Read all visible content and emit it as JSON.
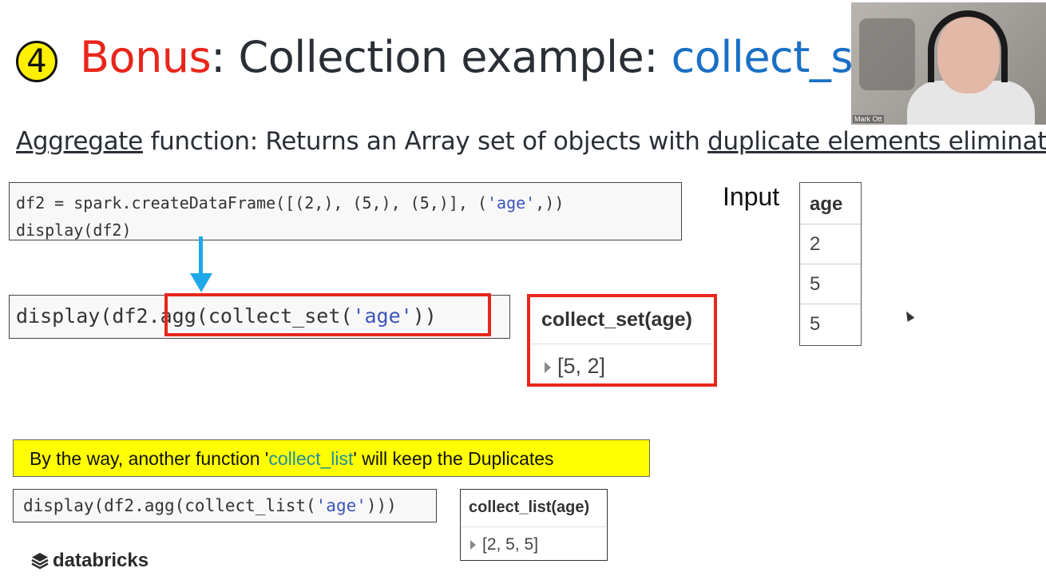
{
  "title": {
    "number": "4",
    "bonus": "Bonus",
    "separator": ": Collection example: ",
    "function_name": "collect_set"
  },
  "webcam": {
    "name": "Mark Ott"
  },
  "subtitle": {
    "part1": "Aggregate",
    "part2": " function: Returns an Array set of objects with ",
    "part3": "duplicate elements eliminated"
  },
  "code_create": {
    "line1_a": "df2 = spark.createDataFrame([(2,), (5,), (5,)], (",
    "line1_str": "'age'",
    "line1_b": ",))",
    "line2": "display(df2)"
  },
  "code_agg": {
    "a": "display(df2.agg(collect_set(",
    "str": "'age'",
    "b": "))"
  },
  "result_set": {
    "header": "collect_set(age)",
    "value": "[5, 2]"
  },
  "input": {
    "label": "Input",
    "header": "age",
    "values": [
      "2",
      "5",
      "5"
    ]
  },
  "note": {
    "a": "By the way, another function '",
    "fn": "collect_list",
    "b": "' will keep the Duplicates"
  },
  "code_list": {
    "a": "display(df2.agg(collect_list(",
    "str": "'age'",
    "b": ")))"
  },
  "result_list": {
    "header": "collect_list(age)",
    "value": "[2, 5, 5]"
  },
  "logo": {
    "text": "databricks"
  },
  "colors": {
    "bonus_red": "#e8261b",
    "function_blue": "#1a70c4",
    "arrow_blue": "#1ea8e8",
    "highlight_red": "#e8261b",
    "note_yellow": "#ffff00"
  }
}
